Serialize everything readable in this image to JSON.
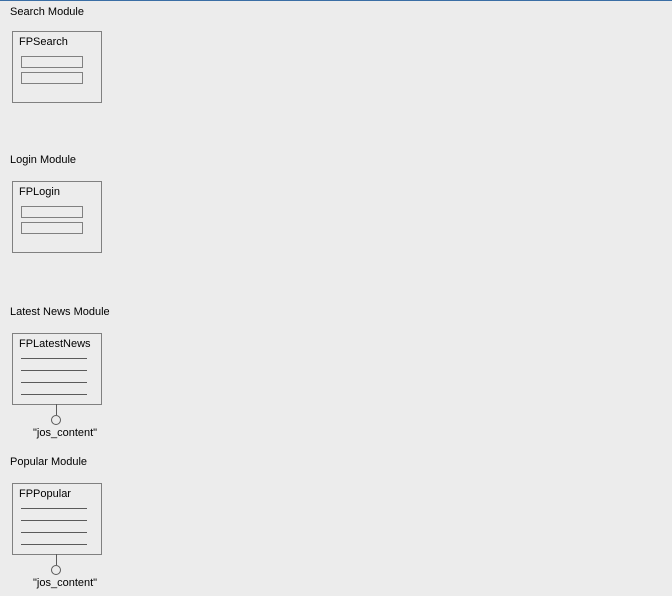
{
  "groups": {
    "search": {
      "label": "Search Module",
      "box_title": "FPSearch"
    },
    "login": {
      "label": "Login Module",
      "box_title": "FPLogin"
    },
    "latest": {
      "label": "Latest News Module",
      "box_title": "FPLatestNews",
      "db": "\"jos_content\""
    },
    "popular": {
      "label": "Popular Module",
      "box_title": "FPPopular",
      "db": "\"jos_content\""
    }
  }
}
